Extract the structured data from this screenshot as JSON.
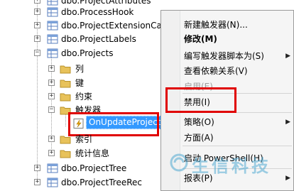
{
  "tree": {
    "rows": [
      {
        "id": "r0",
        "label": "dbo.ProjectAttributes",
        "kind": "table",
        "expander": "+"
      },
      {
        "id": "r1",
        "label": "dbo.ProcessHook",
        "kind": "table",
        "expander": "+"
      },
      {
        "id": "r2",
        "label": "dbo.ProjectExtensionCa",
        "kind": "table",
        "expander": "+"
      },
      {
        "id": "r3",
        "label": "dbo.ProjectLabels",
        "kind": "table",
        "expander": "+"
      },
      {
        "id": "r4",
        "label": "dbo.Projects",
        "kind": "table",
        "expander": "−"
      },
      {
        "id": "r5",
        "label": "列",
        "kind": "folder",
        "expander": "+"
      },
      {
        "id": "r6",
        "label": "键",
        "kind": "folder",
        "expander": "+"
      },
      {
        "id": "r7",
        "label": "约束",
        "kind": "folder",
        "expander": "+"
      },
      {
        "id": "r8",
        "label": "触发器",
        "kind": "folder",
        "expander": "−"
      },
      {
        "id": "r9",
        "label": "OnUpdateProject",
        "kind": "trigger",
        "expander": ""
      },
      {
        "id": "r10",
        "label": "索引",
        "kind": "folder",
        "expander": "+"
      },
      {
        "id": "r11",
        "label": "统计信息",
        "kind": "folder",
        "expander": "+"
      },
      {
        "id": "r12",
        "label": "dbo.ProjectTree",
        "kind": "table",
        "expander": "+"
      },
      {
        "id": "r13",
        "label": "dbo.ProjectTreeRec",
        "kind": "table",
        "expander": "+"
      }
    ]
  },
  "context_menu": {
    "items": [
      {
        "label": "新建触发器(N)...",
        "disabled": false,
        "bold": false,
        "submenu": false
      },
      {
        "label": "修改(M)",
        "disabled": false,
        "bold": true,
        "submenu": false
      },
      {
        "label": "编写触发器脚本为(S)",
        "disabled": false,
        "bold": false,
        "submenu": true
      },
      {
        "label": "查看依赖关系(V)",
        "disabled": false,
        "bold": false,
        "submenu": false
      },
      {
        "label": "启用(E)",
        "disabled": true,
        "bold": false,
        "submenu": false
      },
      {
        "label": "禁用(I)",
        "disabled": false,
        "bold": false,
        "submenu": false
      },
      {
        "label": "策略(O)",
        "disabled": false,
        "bold": false,
        "submenu": true
      },
      {
        "label": "方面(A)",
        "disabled": false,
        "bold": false,
        "submenu": false
      },
      {
        "label": "启动 PowerShell(H)",
        "disabled": false,
        "bold": false,
        "submenu": false
      },
      {
        "label": "报表(P)",
        "disabled": false,
        "bold": false,
        "submenu": true
      }
    ]
  },
  "watermark": {
    "text": "生信科技"
  },
  "colors": {
    "selection": "#3399ff",
    "highlight_box": "#e00000",
    "folder": "#e8c25a",
    "table": "#5a7fbf"
  }
}
